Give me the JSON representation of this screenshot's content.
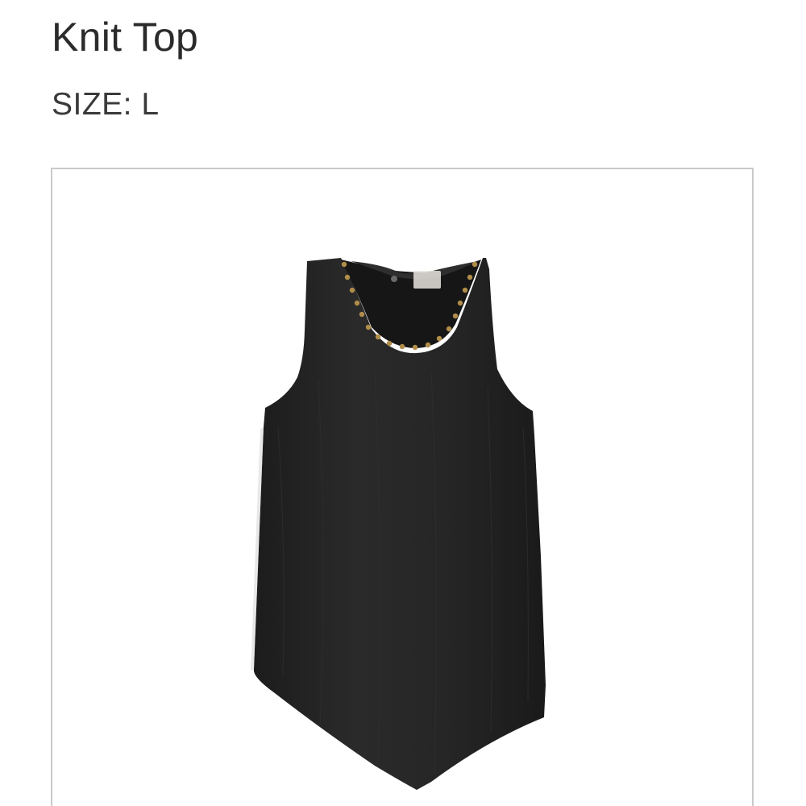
{
  "product": {
    "title_line_1": "",
    "title_line_2": "Knit Top",
    "size_text": "SIZE: L"
  },
  "image": {
    "subject": "black-sleeveless-top-with-studded-neckline-icon"
  },
  "colors": {
    "garment": "#232323",
    "studs": "#b08d4a",
    "frame_border": "#c9c9c9",
    "text": "#2b2b2b"
  }
}
